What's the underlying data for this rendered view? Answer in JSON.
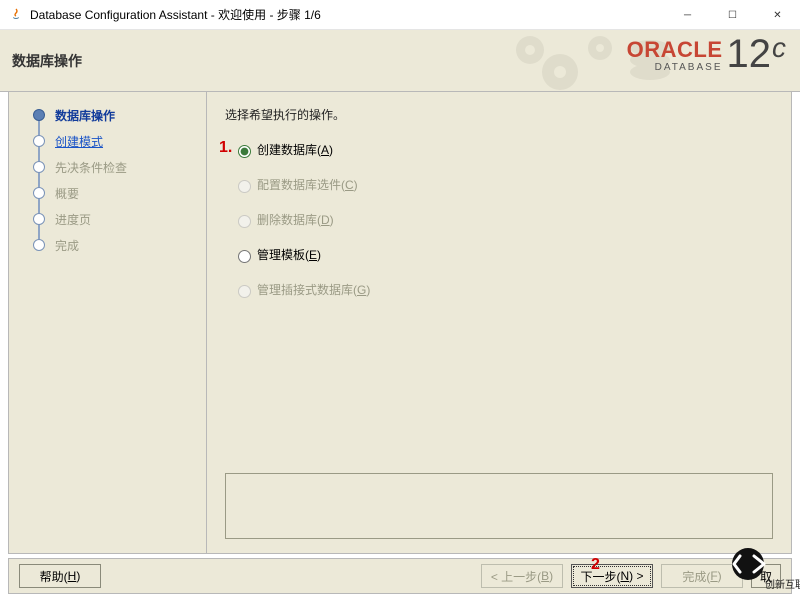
{
  "window": {
    "title": "Database Configuration Assistant - 欢迎使用 - 步骤 1/6"
  },
  "header": {
    "page_title": "数据库操作",
    "brand_oracle": "ORACLE",
    "brand_database": "DATABASE",
    "brand_version_num": "12",
    "brand_version_c": "c"
  },
  "sidebar": {
    "steps": [
      {
        "label": "数据库操作",
        "state": "active"
      },
      {
        "label": "创建模式",
        "state": "link"
      },
      {
        "label": "先决条件检查",
        "state": "disabled"
      },
      {
        "label": "概要",
        "state": "disabled"
      },
      {
        "label": "进度页",
        "state": "disabled"
      },
      {
        "label": "完成",
        "state": "disabled"
      }
    ]
  },
  "main": {
    "instruction": "选择希望执行的操作。",
    "options": [
      {
        "label_pre": "创建数据库(",
        "mn": "A",
        "label_post": ")",
        "selected": true,
        "enabled": true
      },
      {
        "label_pre": "配置数据库选件(",
        "mn": "C",
        "label_post": ")",
        "selected": false,
        "enabled": false
      },
      {
        "label_pre": "删除数据库(",
        "mn": "D",
        "label_post": ")",
        "selected": false,
        "enabled": false
      },
      {
        "label_pre": "管理模板(",
        "mn": "E",
        "label_post": ")",
        "selected": false,
        "enabled": true
      },
      {
        "label_pre": "管理插接式数据库(",
        "mn": "G",
        "label_post": ")",
        "selected": false,
        "enabled": false
      }
    ]
  },
  "annotations": {
    "mark1": "1.",
    "mark2": "2"
  },
  "footer": {
    "help": {
      "pre": "帮助(",
      "mn": "H",
      "post": ")",
      "enabled": true
    },
    "back": {
      "pre": "< 上一步(",
      "mn": "B",
      "post": ")",
      "enabled": false
    },
    "next": {
      "pre": "下一步(",
      "mn": "N",
      "post": ") >",
      "enabled": true,
      "focused": true
    },
    "finish": {
      "pre": "完成(",
      "mn": "F",
      "post": ")",
      "enabled": false
    },
    "cancel": {
      "pre": "取",
      "mn": "",
      "post": "",
      "enabled": true
    }
  },
  "watermark": {
    "text": "创新互联"
  }
}
